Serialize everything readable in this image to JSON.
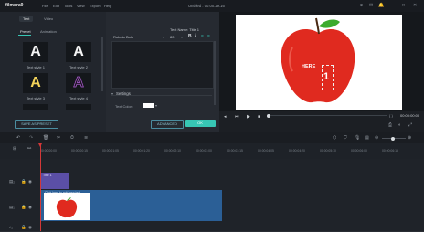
{
  "app": {
    "name": "filmora9",
    "menu": [
      "File",
      "Edit",
      "Tools",
      "View",
      "Export",
      "Help"
    ],
    "title": "Untitled : 00:00:29:16"
  },
  "library": {
    "tabs": [
      "Text",
      "Video"
    ],
    "subtabs": [
      "Preset",
      "Animation"
    ],
    "styles": [
      {
        "glyph": "A",
        "label": "Text style 1"
      },
      {
        "glyph": "A",
        "label": "Text style 2"
      },
      {
        "glyph": "A",
        "label": "Text style 3"
      },
      {
        "glyph": "A",
        "label": "Text style 4"
      }
    ],
    "save_preset": "SAVE AS PRESET"
  },
  "editor": {
    "text_name_label": "Text Name: Title 1",
    "font": "Roboto Bold",
    "font_size": "80",
    "settings_label": "Settings",
    "text_color_label": "Text Color:",
    "advanced_label": "ADVANCED",
    "ok_label": "OK"
  },
  "preview": {
    "overlay_text": "HERE",
    "number_text": "1",
    "timecode": "00:00:00:00",
    "progress": 0.0
  },
  "timeline": {
    "ticks": [
      "00:00:00:00",
      "00:00:00:15",
      "00:00:01:05",
      "00:00:01:20",
      "00:00:02:10",
      "00:00:03:00",
      "00:00:03:15",
      "00:00:04:05",
      "00:00:04:20",
      "00:00:05:10",
      "00:00:06:00",
      "00:00:06:15"
    ],
    "title_clip": "Title 1",
    "video_clip": "Click here to add new text"
  },
  "colors": {
    "accent": "#37c6b4",
    "title_clip": "#5b4fa6",
    "video_clip": "#2b5f96",
    "playhead": "#d33838",
    "apple_red": "#e02a1f"
  }
}
